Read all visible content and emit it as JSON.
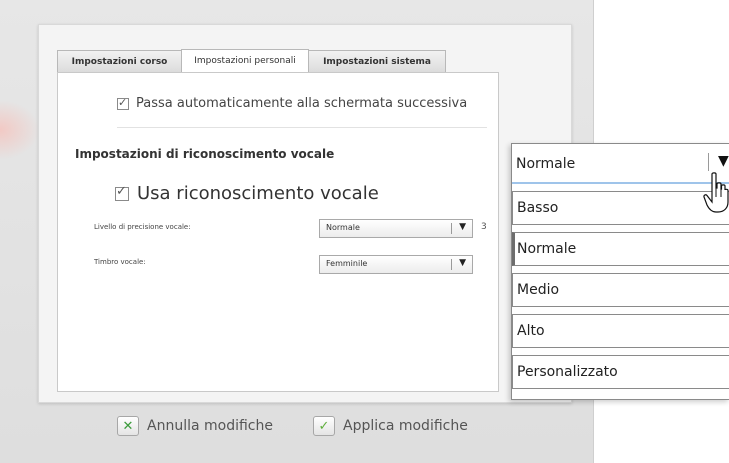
{
  "tabs": {
    "course": "Impostazioni corso",
    "personal": "Impostazioni personali",
    "system": "Impostazioni sistema"
  },
  "auto_next": {
    "label": "Passa automaticamente alla schermata successiva",
    "checked": true
  },
  "voice_section": {
    "title": "Impostazioni di riconoscimento vocale",
    "use_voice_label": "Usa riconoscimento vocale",
    "use_voice_checked": true,
    "precision_label": "Livello di precisione vocale:",
    "precision_value": "Normale",
    "precision_count": "3",
    "timbre_label": "Timbro vocale:",
    "timbre_value": "Femminile"
  },
  "footer": {
    "cancel_label": "Annulla modifiche",
    "apply_label": "Applica modifiche"
  },
  "dropdown": {
    "selected": "Normale",
    "options": [
      "Basso",
      "Normale",
      "Medio",
      "Alto",
      "Personalizzato"
    ]
  },
  "icons": {
    "checkbox_mark": "check-icon",
    "dropdown_arrow": "chevron-down-icon",
    "cursor": "hand-pointer-icon",
    "cancel": "x-icon",
    "apply": "check-icon"
  },
  "colors": {
    "focus_underline": "#9fc4ea",
    "cancel_icon": "#3a9a3a",
    "apply_icon": "#5fae3c"
  }
}
